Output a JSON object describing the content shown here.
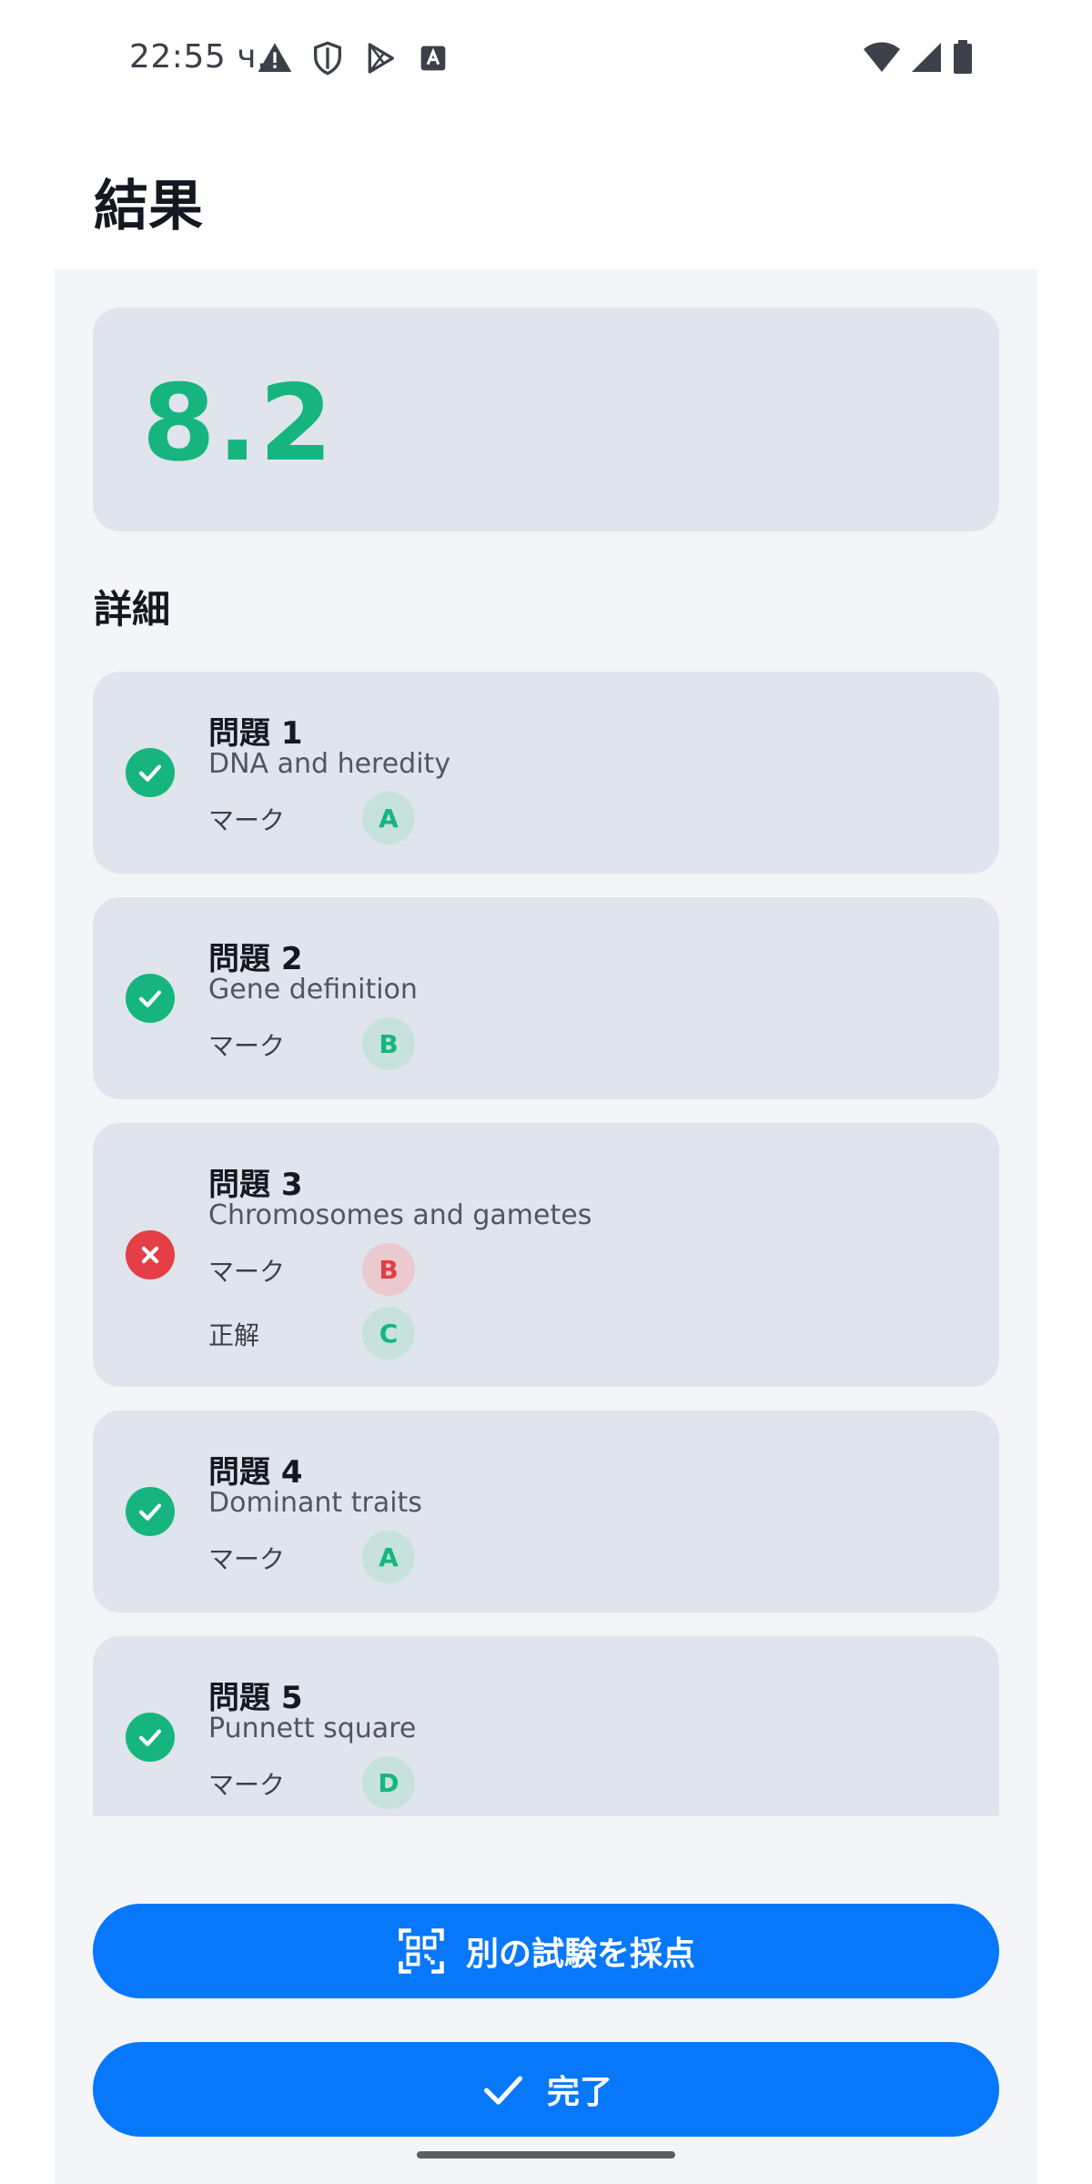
{
  "status_bar": {
    "time": "22:55 ч.",
    "left_icons": [
      "warning-icon",
      "shield-icon",
      "play-store-icon",
      "text-icon"
    ],
    "right_icons": [
      "wifi-icon",
      "signal-icon",
      "battery-icon"
    ]
  },
  "page": {
    "title": "結果"
  },
  "score": {
    "value": "8.2",
    "color": "#16b57f"
  },
  "details": {
    "title": "詳細",
    "mark_label": "マーク",
    "correct_label": "正解",
    "questions": [
      {
        "title": "問題 1",
        "subtitle": "DNA and heredity",
        "status": "correct",
        "mark": "A"
      },
      {
        "title": "問題 2",
        "subtitle": "Gene definition",
        "status": "correct",
        "mark": "B"
      },
      {
        "title": "問題 3",
        "subtitle": "Chromosomes and gametes",
        "status": "incorrect",
        "mark": "B",
        "correct": "C"
      },
      {
        "title": "問題 4",
        "subtitle": "Dominant traits",
        "status": "correct",
        "mark": "A"
      },
      {
        "title": "問題 5",
        "subtitle": "Punnett square",
        "status": "correct",
        "mark": "D"
      }
    ]
  },
  "actions": {
    "grade_another": "別の試験を採点",
    "done": "完了"
  },
  "colors": {
    "accent": "#0878fa",
    "correct": "#16b57f",
    "incorrect": "#e53e46"
  }
}
